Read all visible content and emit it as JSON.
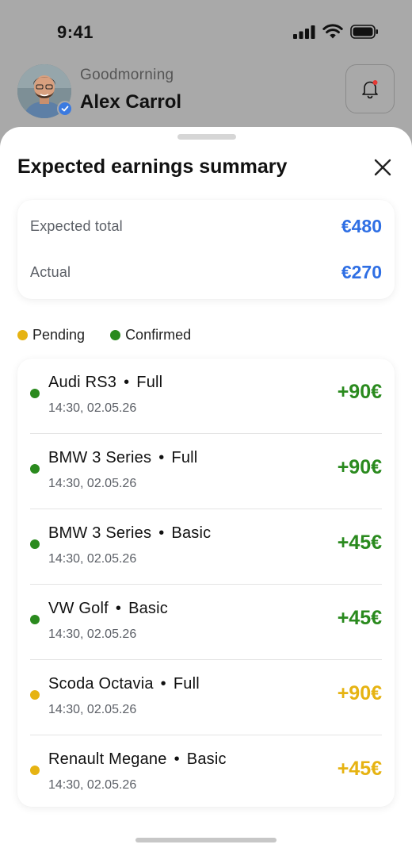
{
  "status_bar": {
    "time": "9:41"
  },
  "header": {
    "greeting": "Goodmorning",
    "name": "Alex Carrol"
  },
  "sheet": {
    "title": "Expected earnings summary"
  },
  "summary": {
    "expected_label": "Expected total",
    "expected_value": "€480",
    "actual_label": "Actual",
    "actual_value": "€270"
  },
  "legend": {
    "pending": "Pending",
    "confirmed": "Confirmed"
  },
  "colors": {
    "pending": "#e6b312",
    "confirmed": "#2a8a1e",
    "accent": "#2f6fe4"
  },
  "items": [
    {
      "car": "Audi RS3",
      "type": "Full",
      "datetime": "14:30, 02.05.26",
      "amount": "+90€",
      "status": "confirmed"
    },
    {
      "car": "BMW 3 Series",
      "type": "Full",
      "datetime": "14:30, 02.05.26",
      "amount": "+90€",
      "status": "confirmed"
    },
    {
      "car": "BMW 3 Series",
      "type": "Basic",
      "datetime": "14:30, 02.05.26",
      "amount": "+45€",
      "status": "confirmed"
    },
    {
      "car": "VW Golf",
      "type": "Basic",
      "datetime": "14:30, 02.05.26",
      "amount": "+45€",
      "status": "confirmed"
    },
    {
      "car": "Scoda Octavia",
      "type": "Full",
      "datetime": "14:30, 02.05.26",
      "amount": "+90€",
      "status": "pending"
    },
    {
      "car": "Renault Megane",
      "type": "Basic",
      "datetime": "14:30, 02.05.26",
      "amount": "+45€",
      "status": "pending"
    }
  ]
}
